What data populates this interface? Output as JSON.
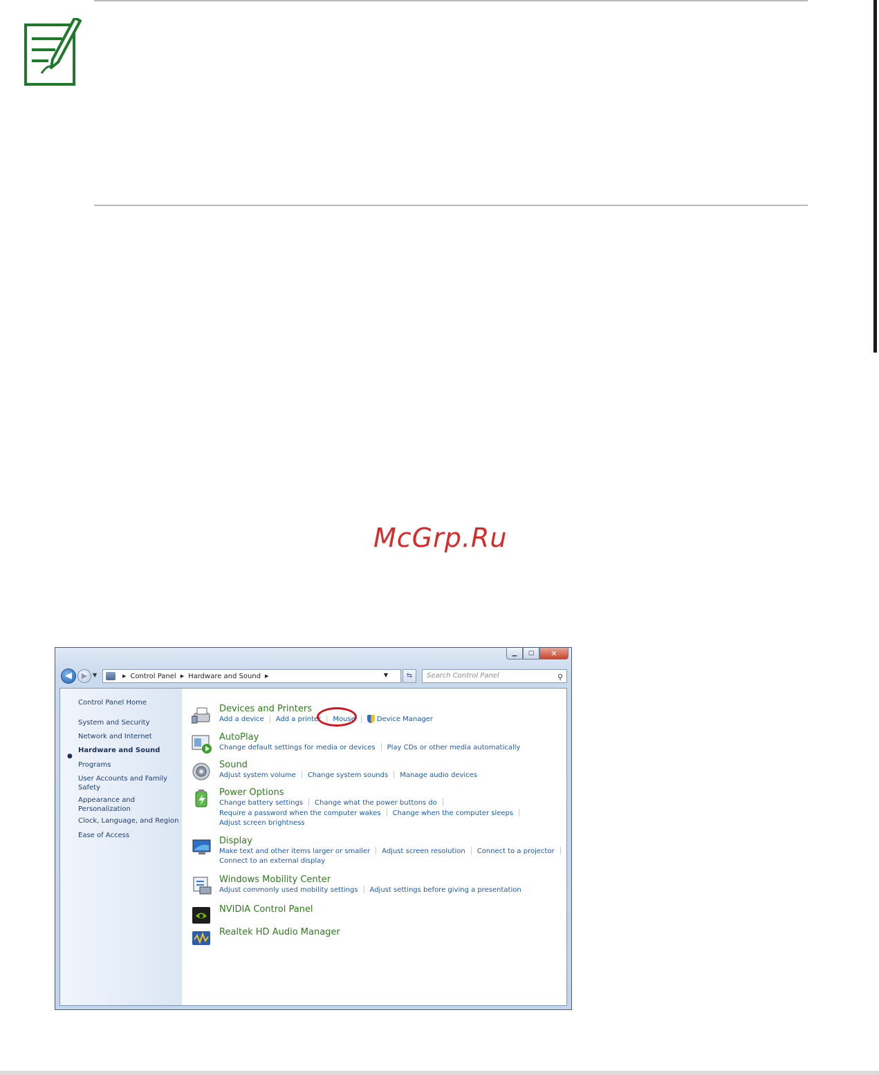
{
  "watermark": "McGrp.Ru",
  "window": {
    "caption": {
      "minimize": "▁",
      "maximize": "▢",
      "close": "✕"
    },
    "address": {
      "crumbs": [
        "Control Panel",
        "Hardware and Sound"
      ]
    },
    "search": {
      "placeholder": "Search Control Panel"
    }
  },
  "nav": {
    "items": [
      {
        "label": "Control Panel Home"
      },
      {
        "label": "System and Security"
      },
      {
        "label": "Network and Internet"
      },
      {
        "label": "Hardware and Sound"
      },
      {
        "label": "Programs"
      },
      {
        "label": "User Accounts and Family Safety"
      },
      {
        "label": "Appearance and Personalization"
      },
      {
        "label": "Clock, Language, and Region"
      },
      {
        "label": "Ease of Access"
      }
    ],
    "active_index": 3
  },
  "categories": [
    {
      "title": "Devices and Printers",
      "lines": [
        [
          "Add a device",
          "Add a printer",
          "Mouse",
          "Device Manager"
        ]
      ]
    },
    {
      "title": "AutoPlay",
      "lines": [
        [
          "Change default settings for media or devices",
          "Play CDs or other media automatically"
        ]
      ]
    },
    {
      "title": "Sound",
      "lines": [
        [
          "Adjust system volume",
          "Change system sounds",
          "Manage audio devices"
        ]
      ]
    },
    {
      "title": "Power Options",
      "lines": [
        [
          "Change battery settings",
          "Change what the power buttons do"
        ],
        [
          "Require a password when the computer wakes",
          "Change when the computer sleeps"
        ],
        [
          "Adjust screen brightness"
        ]
      ]
    },
    {
      "title": "Display",
      "lines": [
        [
          "Make text and other items larger or smaller",
          "Adjust screen resolution",
          "Connect to a projector"
        ],
        [
          "Connect to an external display"
        ]
      ]
    },
    {
      "title": "Windows Mobility Center",
      "lines": [
        [
          "Adjust commonly used mobility settings",
          "Adjust settings before giving a presentation"
        ]
      ]
    },
    {
      "title": "NVIDIA Control Panel",
      "lines": []
    },
    {
      "title": "Realtek HD Audio Manager",
      "lines": []
    }
  ],
  "colors": {
    "link": "#1959b5",
    "category": "#2d7d1a",
    "highlight_ring": "#d3141c",
    "note_icon": "#1e7a2a"
  }
}
